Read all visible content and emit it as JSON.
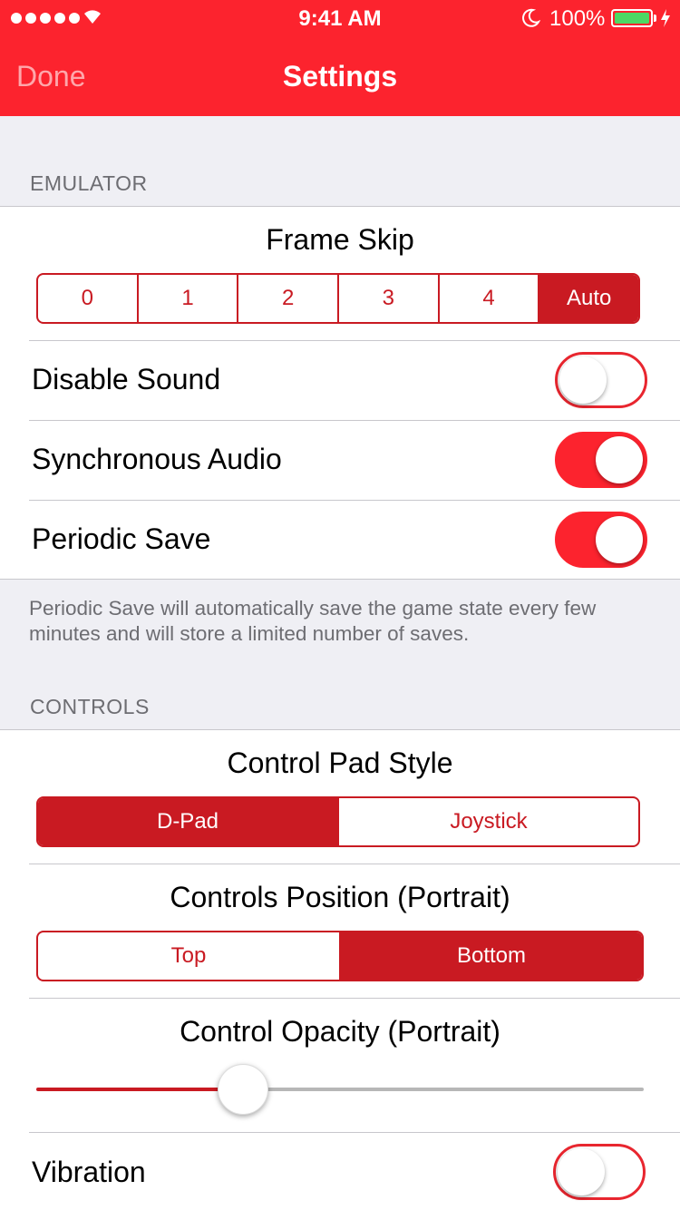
{
  "status_bar": {
    "time": "9:41 AM",
    "battery_percent": "100%",
    "battery_level": 1.0,
    "signal_icon": "signal-dots-icon",
    "wifi_icon": "wifi-icon",
    "moon_icon": "moon-icon"
  },
  "nav": {
    "done_label": "Done",
    "title": "Settings"
  },
  "colors": {
    "brand_red": "#fc232e",
    "segment_red": "#c91a22",
    "background": "#efeff4"
  },
  "emulator": {
    "header": "EMULATOR",
    "frame_skip": {
      "title": "Frame Skip",
      "options": [
        "0",
        "1",
        "2",
        "3",
        "4",
        "Auto"
      ],
      "selected": "Auto"
    },
    "disable_sound": {
      "label": "Disable Sound",
      "on": false
    },
    "synchronous_audio": {
      "label": "Synchronous Audio",
      "on": true
    },
    "periodic_save": {
      "label": "Periodic Save",
      "on": true
    },
    "footer": "Periodic Save will automatically save the game state every few minutes and will store a limited number of saves."
  },
  "controls": {
    "header": "CONTROLS",
    "pad_style": {
      "title": "Control Pad Style",
      "options": [
        "D-Pad",
        "Joystick"
      ],
      "selected": "D-Pad"
    },
    "position": {
      "title": "Controls Position (Portrait)",
      "options": [
        "Top",
        "Bottom"
      ],
      "selected": "Bottom"
    },
    "opacity": {
      "title": "Control Opacity (Portrait)",
      "value": 0.34
    },
    "vibration": {
      "label": "Vibration",
      "on": false
    }
  }
}
